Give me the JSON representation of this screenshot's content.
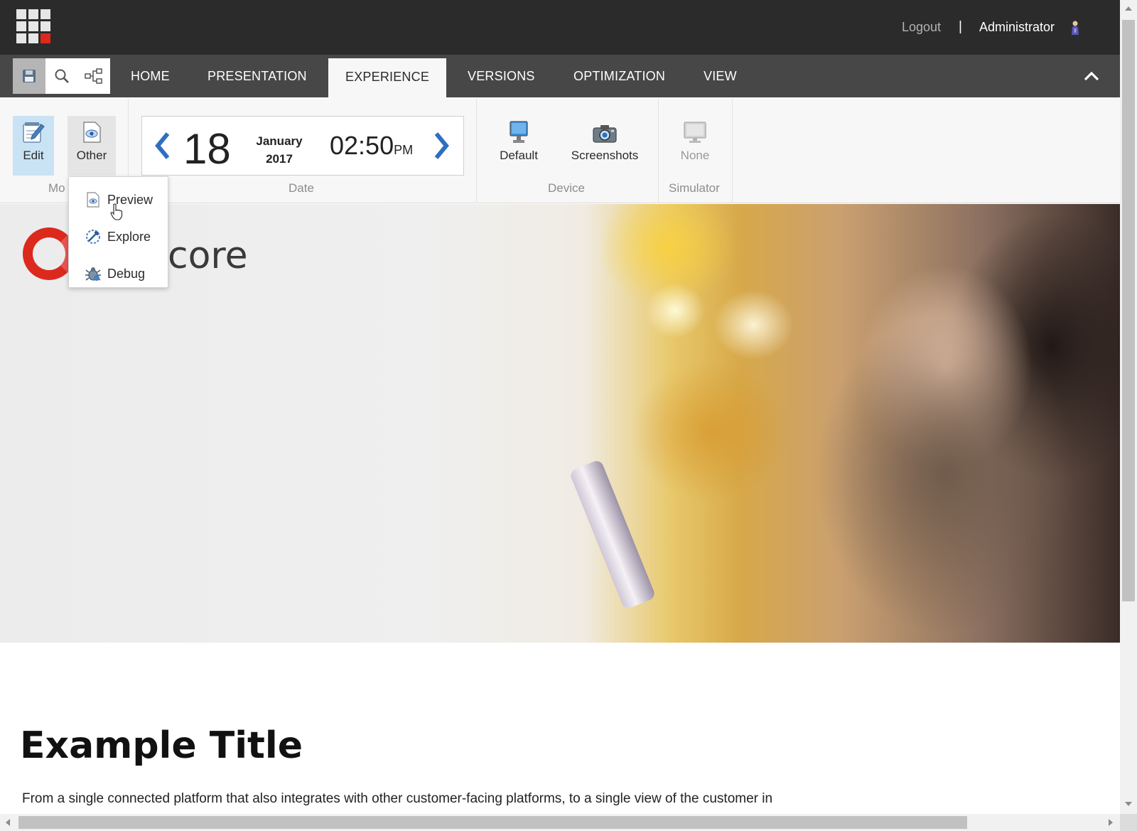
{
  "topbar": {
    "logout_label": "Logout",
    "separator": "|",
    "user_name": "Administrator",
    "accent_color": "#dc291e"
  },
  "tabs": [
    {
      "label": "HOME"
    },
    {
      "label": "PRESENTATION"
    },
    {
      "label": "EXPERIENCE",
      "active": true
    },
    {
      "label": "VERSIONS"
    },
    {
      "label": "OPTIMIZATION"
    },
    {
      "label": "VIEW"
    }
  ],
  "quick_actions": [
    "save-icon",
    "search-icon",
    "navigator-icon"
  ],
  "ribbon": {
    "mode": {
      "label": "Mo",
      "edit_label": "Edit",
      "other_label": "Other"
    },
    "date": {
      "label": "Date",
      "day": "18",
      "month": "January",
      "year": "2017",
      "time": "02:50",
      "ampm": "PM"
    },
    "device": {
      "label": "Device",
      "default_label": "Default",
      "screenshots_label": "Screenshots"
    },
    "simulator": {
      "label": "Simulator",
      "none_label": "None"
    }
  },
  "dropdown": {
    "items": [
      {
        "label": "Preview",
        "icon": "preview-icon"
      },
      {
        "label": "Explore",
        "icon": "explore-icon"
      },
      {
        "label": "Debug",
        "icon": "debug-icon"
      }
    ]
  },
  "page": {
    "logo_text": "core",
    "title": "Example Title",
    "body_text": "From a single connected platform that also integrates with other customer-facing platforms, to a single view of the customer in"
  }
}
